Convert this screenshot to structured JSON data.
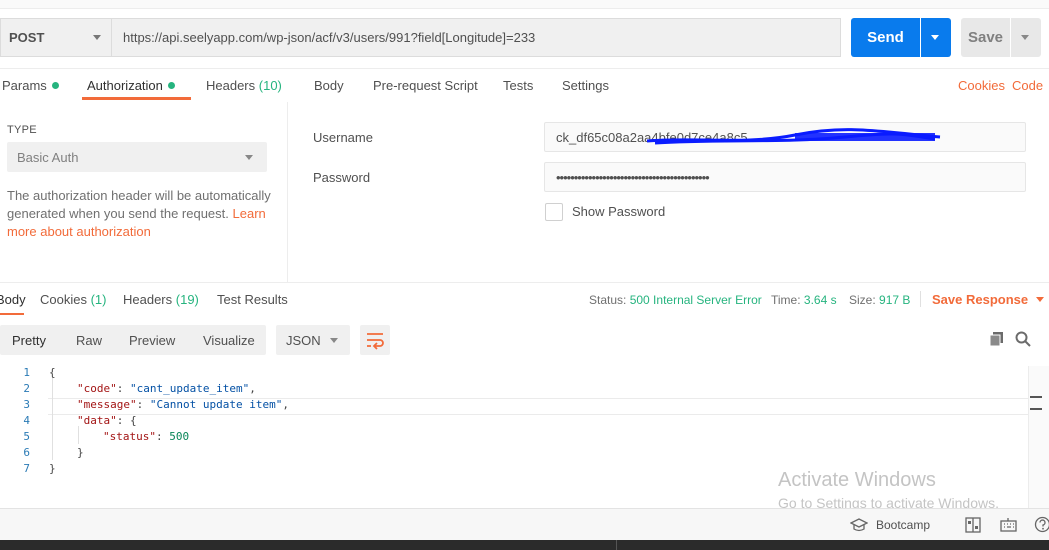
{
  "request": {
    "method": "POST",
    "url": "https://api.seelyapp.com/wp-json/acf/v3/users/991?field[Longitude]=233",
    "send_label": "Send",
    "save_label": "Save"
  },
  "request_tabs": [
    {
      "label": "Params",
      "dot": true
    },
    {
      "label": "Authorization",
      "dot": true,
      "active": true
    },
    {
      "label": "Headers",
      "count": "(10)"
    },
    {
      "label": "Body"
    },
    {
      "label": "Pre-request Script"
    },
    {
      "label": "Tests"
    },
    {
      "label": "Settings"
    }
  ],
  "right_links": {
    "cookies": "Cookies",
    "code": "Code"
  },
  "auth": {
    "type_label": "TYPE",
    "type_value": "Basic Auth",
    "description": "The authorization header will be automatically generated when you send the request.",
    "learn_more": "Learn more about authorization",
    "username_label": "Username",
    "username_value": "ck_df65c08a2aa4bfe0d7ce4a8c5",
    "password_label": "Password",
    "password_value": "•••••••••••••••••••••••••••••••••••••••••••",
    "show_password": "Show Password"
  },
  "response_tabs": [
    {
      "label": "Body",
      "active": true
    },
    {
      "label": "Cookies",
      "count": "(1)"
    },
    {
      "label": "Headers",
      "count": "(19)"
    },
    {
      "label": "Test Results"
    }
  ],
  "response_meta": {
    "status_label": "Status:",
    "status_value": "500 Internal Server Error",
    "time_label": "Time:",
    "time_value": "3.64 s",
    "size_label": "Size:",
    "size_value": "917 B",
    "save_response": "Save Response"
  },
  "view_modes": [
    "Pretty",
    "Raw",
    "Preview",
    "Visualize"
  ],
  "format": "JSON",
  "code_lines": {
    "n1": "1",
    "n2": "2",
    "n3": "3",
    "n4": "4",
    "n5": "5",
    "n6": "6",
    "n7": "7",
    "open_brace": "{",
    "code_key": "\"code\"",
    "code_val": "\"cant_update_item\"",
    "message_key": "\"message\"",
    "message_val": "\"Cannot update item\"",
    "data_key": "\"data\"",
    "status_key": "\"status\"",
    "status_val": "500",
    "inner_close": "}",
    "close_brace": "}"
  },
  "watermark": {
    "line1": "Activate Windows",
    "line2": "Go to Settings to activate Windows."
  },
  "statusbar": {
    "bootcamp": "Bootcamp"
  },
  "colors": {
    "accent": "#f26b3a",
    "primary": "#097bed",
    "success": "#26b47f"
  }
}
